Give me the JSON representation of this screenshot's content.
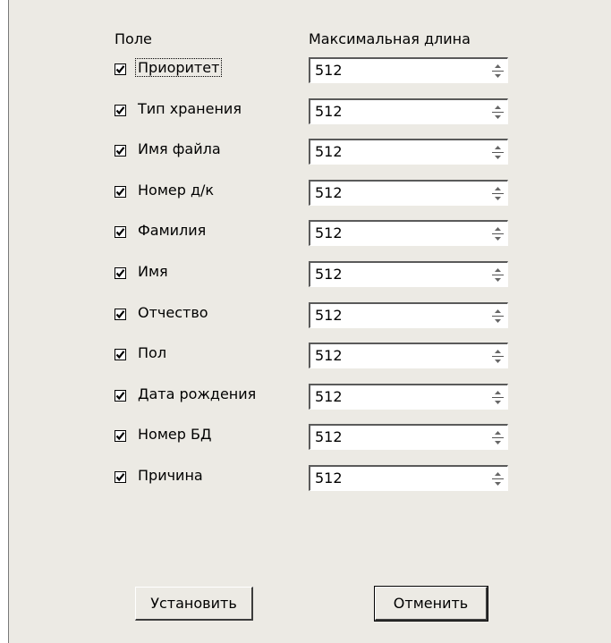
{
  "header": {
    "field_label": "Поле",
    "length_label": "Максимальная длина"
  },
  "rows": [
    {
      "label": "Приоритет",
      "checked": true,
      "value": "512"
    },
    {
      "label": "Тип хранения",
      "checked": true,
      "value": "512"
    },
    {
      "label": "Имя файла",
      "checked": true,
      "value": "512"
    },
    {
      "label": "Номер д/к",
      "checked": true,
      "value": "512"
    },
    {
      "label": "Фамилия",
      "checked": true,
      "value": "512"
    },
    {
      "label": "Имя",
      "checked": true,
      "value": "512"
    },
    {
      "label": "Отчество",
      "checked": true,
      "value": "512"
    },
    {
      "label": "Пол",
      "checked": true,
      "value": "512"
    },
    {
      "label": "Дата рождения",
      "checked": true,
      "value": "512"
    },
    {
      "label": "Номер БД",
      "checked": true,
      "value": "512"
    },
    {
      "label": "Причина",
      "checked": true,
      "value": "512"
    }
  ],
  "buttons": {
    "apply_label": "Установить",
    "cancel_label": "Отменить"
  },
  "icons": {
    "checkbox_mark": "checkmark-icon",
    "spin_up": "arrow-up-icon",
    "spin_down": "arrow-down-icon"
  }
}
